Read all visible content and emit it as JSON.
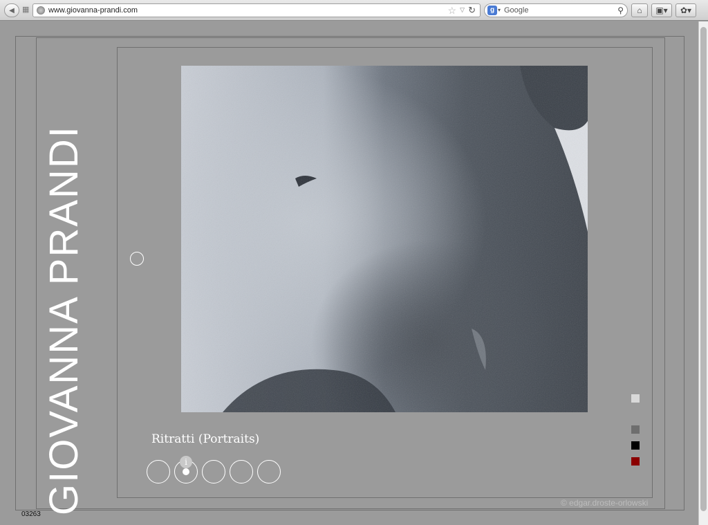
{
  "browser": {
    "url": "www.giovanna-prandi.com",
    "search_placeholder": "Google",
    "google_badge": "g",
    "icons": [
      "back-arrow-icon",
      "grid-icon",
      "globe-icon",
      "star-icon",
      "reload-icon",
      "magnifier-icon",
      "home-icon",
      "bookmark-icon",
      "extension-icon"
    ]
  },
  "site": {
    "brand": "GIOVANNA PRANDI",
    "gallery_title": "Ritratti (Portraits)",
    "info_label": "i",
    "thumbnail_count": 5,
    "active_thumbnail": 2,
    "credit": "© edgar.droste-orlowski",
    "counter": "03263",
    "swatches": [
      "#d9d9d9",
      "#6e6e6e",
      "#000000",
      "#8b0000"
    ]
  }
}
